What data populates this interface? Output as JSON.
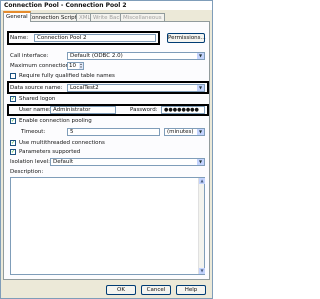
{
  "window": {
    "title": "Connection Pool - Connection Pool 2"
  },
  "tabs": [
    {
      "label": "General",
      "active": true,
      "enabled": true
    },
    {
      "label": "Connection Scripts",
      "active": false,
      "enabled": true
    },
    {
      "label": "XML",
      "active": false,
      "enabled": false
    },
    {
      "label": "Write Back",
      "active": false,
      "enabled": false
    },
    {
      "label": "Miscellaneous",
      "active": false,
      "enabled": false
    }
  ],
  "form": {
    "name_label": "Name:",
    "name_value": "Connection Pool 2",
    "permissions_button": "Permissions...",
    "call_interface_label": "Call interface:",
    "call_interface_value": "Default (ODBC 2.0)",
    "max_connections_label": "Maximum connections:",
    "max_connections_value": "10",
    "require_qualified_label": "Require fully qualified table names",
    "require_qualified_checked": false,
    "dsn_label": "Data source name:",
    "dsn_value": "LocalTest2",
    "shared_logon_label": "Shared logon",
    "shared_logon_checked": true,
    "user_name_label": "User name:",
    "user_name_value": "Administrator",
    "password_label": "Password:",
    "password_value": "●●●●●●●●",
    "enable_pooling_label": "Enable connection pooling",
    "enable_pooling_checked": true,
    "timeout_label": "Timeout:",
    "timeout_value": "5",
    "timeout_unit": "(minutes)",
    "multithreaded_label": "Use multithreaded connections",
    "multithreaded_checked": true,
    "parameters_label": "Parameters supported",
    "parameters_checked": true,
    "isolation_label": "Isolation level:",
    "isolation_value": "Default",
    "description_label": "Description:",
    "description_value": ""
  },
  "buttons": {
    "ok": "OK",
    "cancel": "Cancel",
    "help": "Help"
  },
  "icons": {
    "checkmark": "✓",
    "dropdown": "▼",
    "spin_up": "▲",
    "spin_down": "▼"
  }
}
